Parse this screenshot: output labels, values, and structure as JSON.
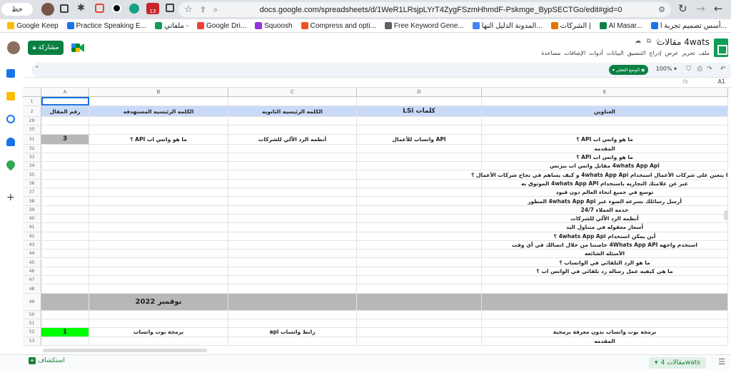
{
  "browser": {
    "tab_label": "حظ",
    "url": "docs.google.com/spreadsheets/d/1WeR1LRsjpLYrT4ZygFSzmHhmdF-Pskmge_BypSECTGo/edit#gid=0",
    "badge": "13",
    "bookmarks": [
      {
        "label": "أسس تصميم تجربة ا...",
        "color": "#1a73e8"
      },
      {
        "label": "Al Masar...",
        "color": "#0b8043"
      },
      {
        "label": "الشركات |",
        "color": "#e37400"
      },
      {
        "label": "المدونة الدليل النها...",
        "color": "#4285f4"
      },
      {
        "label": "Free Keyword Gene...",
        "color": "#5f6368"
      },
      {
        "label": "Compress and opti...",
        "color": "#f4511e"
      },
      {
        "label": "Squoosh",
        "color": "#9334e6"
      },
      {
        "label": "Google Dri...",
        "color": "#ea4335"
      },
      {
        "label": "ملفاتي -",
        "color": "#0f9d58"
      },
      {
        "label": "Practice Speaking E...",
        "color": "#1a73e8"
      },
      {
        "label": "Google Keep",
        "color": "#fbbc04"
      }
    ]
  },
  "sheets": {
    "title": "4wats مقالات",
    "share_label": "مشاركة",
    "menu": [
      "ملف",
      "تحرير",
      "عرض",
      "إدراج",
      "التنسيق",
      "البيانات",
      "أدوات",
      "الإضافات",
      "مساعدة"
    ],
    "mode_label": "الوضع الفعلي",
    "zoom": "100%",
    "cell_ref": "A1",
    "fx": "fx",
    "sheet_tab": "مقالات 4wats",
    "add_sheet_label": "استكشاف"
  },
  "grid": {
    "columns": [
      "A",
      "B",
      "C",
      "D",
      "E"
    ],
    "header_row": {
      "A": "رقم المقال",
      "B": "الكلمه الرئيسيه المستهدفه",
      "C": "الكلمه الرئيسيه الثانويه",
      "D": "كلمات LSi",
      "E": "العناوين"
    },
    "rows": [
      {
        "n": "1",
        "A": "",
        "B": "",
        "C": "",
        "D": "",
        "E": ""
      },
      {
        "n": "2",
        "A": "رقم المقال",
        "B": "الكلمه الرئيسيه المستهدفه",
        "C": "الكلمه الرئيسيه الثانويه",
        "D": "كلمات LSi",
        "E": "العناوين"
      },
      {
        "n": "29",
        "E": ""
      },
      {
        "n": "30",
        "E": ""
      },
      {
        "n": "31",
        "A": "3",
        "B": "ما هو واتس اب API ؟",
        "C": "أنظمه الرد الآلي للشركات",
        "D": "API واتساب للأعمال",
        "E": "ما هو واتس اب API ؟"
      },
      {
        "n": "32",
        "E": "المقدمه"
      },
      {
        "n": "33",
        "E": "ما هو واتس اب API ؟"
      },
      {
        "n": "34",
        "E": "4whats App Api  مقابل واتس اب بيزنس"
      },
      {
        "n": "35",
        "E": "لماذا يتعين على شركات الأعمال استخدام 4whats App Api و كيف يساهم في نجاح شركات الأعمال ؟"
      },
      {
        "n": "36",
        "E": "عبر عن علامتك التجاريه باستخدام 4whats App API الموثوق به"
      },
      {
        "n": "37",
        "E": "توسع في جميع انحاء العالم دون قيود"
      },
      {
        "n": "38",
        "E": "أرسل رسائلك بسرعه الضوء عبر 4whats App Api المطور"
      },
      {
        "n": "39",
        "E": "خدمه العملاء 24/7"
      },
      {
        "n": "40",
        "E": "أنظمه الرد الآلي للشركات"
      },
      {
        "n": "41",
        "E": "أسعار معقوله في متناول اليد"
      },
      {
        "n": "42",
        "E": "أين يمكن استخدام 4whats App Api ؟"
      },
      {
        "n": "43",
        "E": "استخدم واجهه  4Whats App API  خاصتنا من خلال اتصالك في أي وقت"
      },
      {
        "n": "44",
        "E": "الأسئله الشائعه"
      },
      {
        "n": "45",
        "E": "ما هو الرد التلقائي في الواتساب ؟"
      },
      {
        "n": "46",
        "E": "ما هي كيفيه عمل رساله رد تلقائي في الواتس اب ؟"
      },
      {
        "n": "47",
        "E": ""
      },
      {
        "n": "48",
        "E": ""
      },
      {
        "n": "49",
        "B": "نوفمبر 2022"
      },
      {
        "n": "50",
        "E": ""
      },
      {
        "n": "51",
        "E": ""
      },
      {
        "n": "52",
        "A": "1",
        "B": "برمجة بوت واتساب",
        "C": "رابط واتساب api",
        "D": "",
        "E": "برمجة بوت واتساب بدون معرفة برمجية"
      },
      {
        "n": "53",
        "E": "المقدمه"
      }
    ]
  },
  "colors": {
    "header_fill": "#c9daf8",
    "gray_fill": "#b7b7b7",
    "green_fill": "#00ff00",
    "brand_green": "#0f9d58"
  }
}
